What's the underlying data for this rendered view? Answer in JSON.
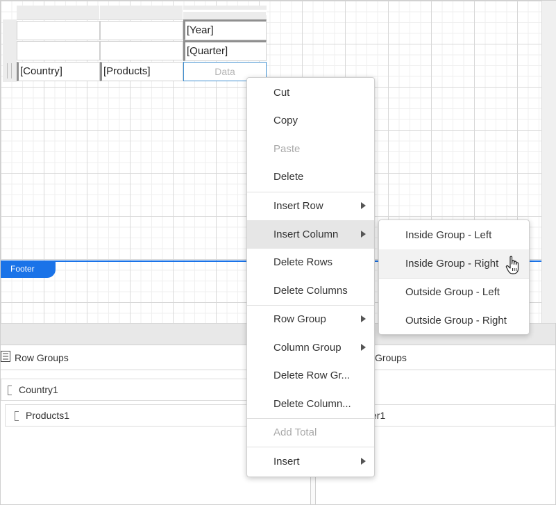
{
  "tablix": {
    "year": "[Year]",
    "quarter": "[Quarter]",
    "country": "[Country]",
    "products": "[Products]",
    "data": "Data"
  },
  "footer": {
    "label": "Footer"
  },
  "row_groups": {
    "title": "Row Groups",
    "items": [
      "Country1",
      "Products1"
    ]
  },
  "column_groups": {
    "title_visible": "Groups",
    "item_visible": "er1"
  },
  "context_menu": {
    "items": [
      {
        "label": "Cut",
        "disabled": false
      },
      {
        "label": "Copy",
        "disabled": false
      },
      {
        "label": "Paste",
        "disabled": true
      },
      {
        "label": "Delete",
        "disabled": false
      },
      {
        "label": "Insert Row",
        "submenu": true
      },
      {
        "label": "Insert Column",
        "submenu": true,
        "active": true
      },
      {
        "label": "Delete Rows"
      },
      {
        "label": "Delete Columns"
      },
      {
        "label": "Row Group",
        "submenu": true
      },
      {
        "label": "Column Group",
        "submenu": true
      },
      {
        "label": "Delete Row Gr..."
      },
      {
        "label": "Delete Column..."
      },
      {
        "label": "Add Total",
        "disabled": true
      },
      {
        "label": "Insert",
        "submenu": true
      }
    ]
  },
  "insert_column_submenu": {
    "items": [
      {
        "label": "Inside Group - Left"
      },
      {
        "label": "Inside Group - Right",
        "hovered": true
      },
      {
        "label": "Outside Group - Left"
      },
      {
        "label": "Outside Group - Right"
      }
    ]
  },
  "colors": {
    "accent": "#1a73e8",
    "hover": "#e6e6e6"
  },
  "icons": [
    "list-icon",
    "hand-pointer-icon",
    "submenu-arrow-icon"
  ]
}
